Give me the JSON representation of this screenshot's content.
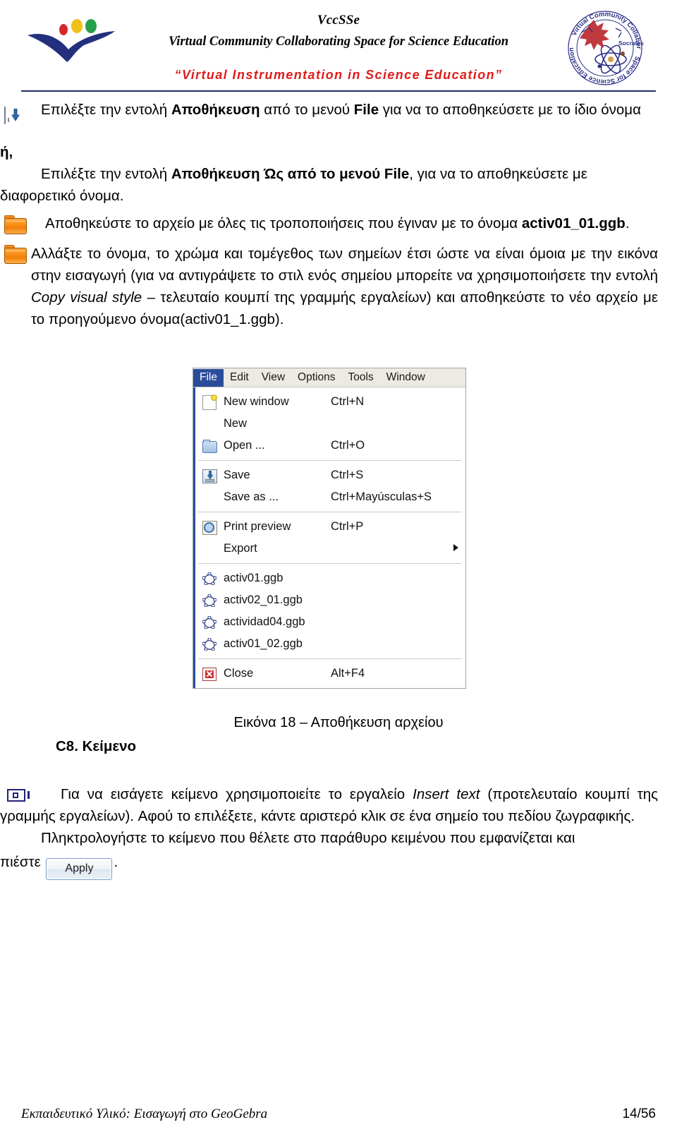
{
  "header": {
    "title": "VccSSe",
    "subtitle": "Virtual Community Collaborating Space for Science Education",
    "slogan": "“Virtual Instrumentation in Science Education”",
    "slogan_color": "#e01b1b",
    "left_logo_name": "vccsse-bird-logo",
    "right_logo_name": "science-education-seal-logo",
    "right_logo_text": "Virtual Community Collaborating Space for Science Education"
  },
  "body": {
    "p1_pre": "Επιλέξτε την εντολή ",
    "p1_b1": "Αποθήκευση",
    "p1_mid": " από το μενού ",
    "p1_b2": "File",
    "p1_post": " για να το αποθηκεύσετε με το ίδιο όνομα",
    "p2": "ή,",
    "p3_pre": "Επιλέξτε την εντολή ",
    "p3_b1": "Αποθήκευση Ώς από το μενού File",
    "p3_post": ", για να το αποθηκεύσετε με διαφορετικό όνομα.",
    "p4_pre": "Αποθηκεύστε το αρχείο με όλες τις τροποποιήσεις που έγιναν με το όνομα ",
    "p4_b": "activ01_01.ggb",
    "p4_post": ".",
    "p5_a": "Αλλάξτε το όνομα, το χρώμα και τομέγεθος των σημείων έτσι ώστε να είναι όμοια με την εικόνα στην εισαγωγή (για να αντιγράψετε το στιλ ενός σημείου μπορείτε να χρησιμοποιήσετε την εντολή ",
    "p5_i": "Copy visual style",
    "p5_b": " – τελευταίο κουμπί της γραμμής εργαλείων) και αποθηκεύστε το νέο αρχείο με το προηγούμενο όνομα(activ01_1.ggb)."
  },
  "figure": {
    "caption": "Εικόνα 18 – Αποθήκευση αρχείου"
  },
  "ggb_menu": {
    "menubar": [
      {
        "label": "File",
        "active": true
      },
      {
        "label": "Edit",
        "active": false
      },
      {
        "label": "View",
        "active": false
      },
      {
        "label": "Options",
        "active": false
      },
      {
        "label": "Tools",
        "active": false
      },
      {
        "label": "Window",
        "active": false
      }
    ],
    "items": [
      {
        "icon": "new-window-icon",
        "label": "New window",
        "accel": "Ctrl+N"
      },
      {
        "icon": "",
        "label": "New",
        "accel": ""
      },
      {
        "icon": "open-folder-icon",
        "label": "Open ...",
        "accel": "Ctrl+O"
      },
      {
        "separator": true
      },
      {
        "icon": "save-disk-icon",
        "label": "Save",
        "accel": "Ctrl+S"
      },
      {
        "icon": "",
        "label": "Save as ...",
        "accel": "Ctrl+Mayúsculas+S"
      },
      {
        "separator": true
      },
      {
        "icon": "print-preview-icon",
        "label": "Print preview",
        "accel": "Ctrl+P"
      },
      {
        "icon": "",
        "label": "Export",
        "accel": "",
        "submenu": true
      },
      {
        "separator": true
      },
      {
        "icon": "ggb-file-icon",
        "label": "activ01.ggb",
        "accel": ""
      },
      {
        "icon": "ggb-file-icon",
        "label": "activ02_01.ggb",
        "accel": ""
      },
      {
        "icon": "ggb-file-icon",
        "label": "actividad04.ggb",
        "accel": ""
      },
      {
        "icon": "ggb-file-icon",
        "label": "activ01_02.ggb",
        "accel": ""
      },
      {
        "separator": true
      },
      {
        "icon": "close-icon",
        "label": "Close",
        "accel": "Alt+F4"
      }
    ]
  },
  "section": {
    "heading": "C8. Κείμενο",
    "p1_pre": "Για να εισάγετε κείμενο χρησιμοποιείτε το εργαλείο ",
    "p1_i": "Insert text",
    "p1_post": "  (προτελευταίο κουμπί της γραμμής εργαλείων). Αφού το επιλέξετε, κάντε αριστερό κλικ σε ένα σημείο του πεδίου ζωγραφικής.",
    "p2_pre": "Πληκτρολογήστε το κείμενο που θέλετε στο παράθυρο κειμένου που εμφανίζεται και",
    "p2_press": "πιέστε",
    "apply_label": "Apply",
    "p2_post": "."
  },
  "footer": {
    "left": "Εκπαιδευτικό Υλικό: Εισαγωγή στο GeoGebra",
    "page": "14/56"
  }
}
